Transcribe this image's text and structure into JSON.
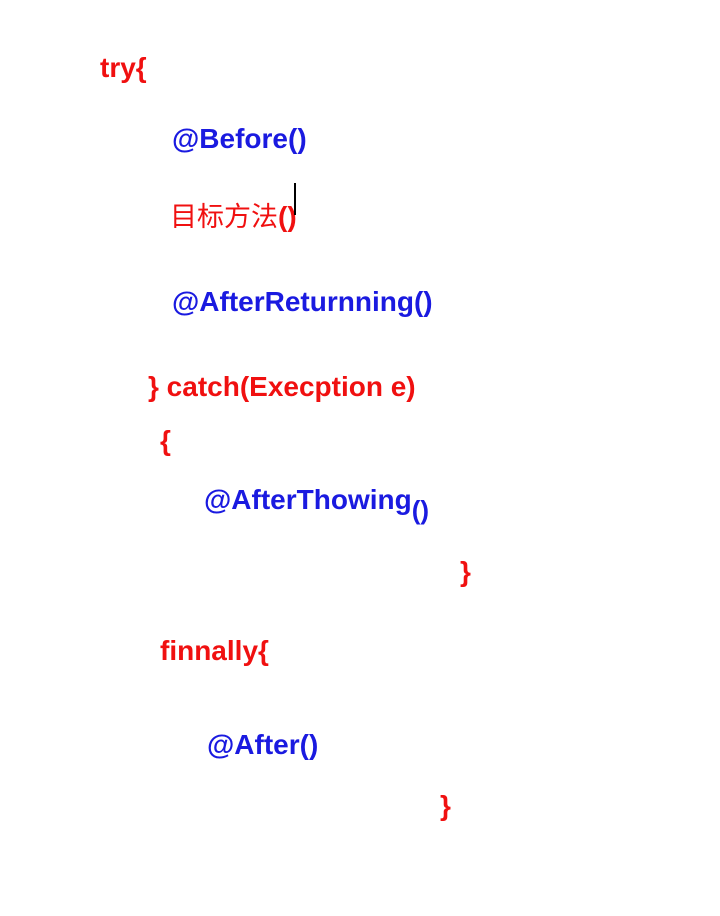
{
  "lines": {
    "try_open": "try{",
    "before": "@Before()",
    "target_method": "目标方法",
    "target_parens": "()",
    "after_returning": "@AfterReturnning()",
    "catch": "} catch(Execption e)",
    "catch_brace_open": "{",
    "after_throwing": "@AfterThowing",
    "after_throwing_parens": "()",
    "catch_brace_close": "}",
    "finally_open": "finnally{",
    "after": "@After()",
    "finally_close": "}"
  },
  "colors": {
    "keyword": "#f01010",
    "annotation": "#1a1ae0"
  }
}
